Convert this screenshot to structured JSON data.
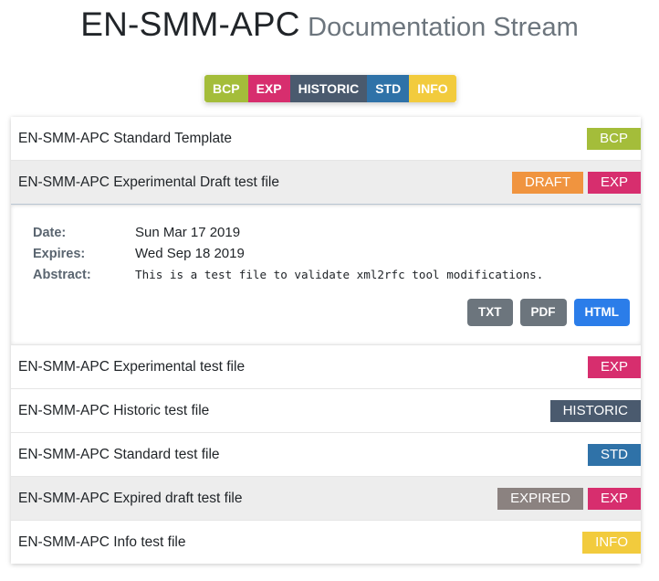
{
  "header": {
    "title": "EN-SMM-APC",
    "subtitle": "Documentation Stream"
  },
  "colors": {
    "bcp": "#a4bd3a",
    "exp": "#d72e6e",
    "historic": "#4a5a6e",
    "std": "#2f72a8",
    "info": "#f2cb3d",
    "draft": "#f0943f",
    "expired": "#8b8280",
    "btn_gray": "#6c757d",
    "btn_blue": "#2b7de9"
  },
  "filters": [
    {
      "label": "BCP",
      "color": "#a4bd3a"
    },
    {
      "label": "EXP",
      "color": "#d72e6e"
    },
    {
      "label": "HISTORIC",
      "color": "#4a5a6e"
    },
    {
      "label": "STD",
      "color": "#2f72a8"
    },
    {
      "label": "INFO",
      "color": "#f2cb3d"
    }
  ],
  "documents": [
    {
      "title": "EN-SMM-APC Standard Template",
      "badges": [
        {
          "label": "BCP",
          "color": "#a4bd3a"
        }
      ]
    },
    {
      "title": "EN-SMM-APC Experimental Draft test file",
      "badges": [
        {
          "label": "DRAFT",
          "color": "#f0943f"
        },
        {
          "label": "EXP",
          "color": "#d72e6e"
        }
      ]
    },
    {
      "title": "EN-SMM-APC Experimental test file",
      "badges": [
        {
          "label": "EXP",
          "color": "#d72e6e"
        }
      ]
    },
    {
      "title": "EN-SMM-APC Historic test file",
      "badges": [
        {
          "label": "HISTORIC",
          "color": "#4a5a6e"
        }
      ]
    },
    {
      "title": "EN-SMM-APC Standard test file",
      "badges": [
        {
          "label": "STD",
          "color": "#2f72a8"
        }
      ]
    },
    {
      "title": "EN-SMM-APC Expired draft test file",
      "badges": [
        {
          "label": "EXPIRED",
          "color": "#8b8280"
        },
        {
          "label": "EXP",
          "color": "#d72e6e"
        }
      ]
    },
    {
      "title": "EN-SMM-APC Info test file",
      "badges": [
        {
          "label": "INFO",
          "color": "#f2cb3d"
        }
      ]
    }
  ],
  "detail": {
    "date_label": "Date:",
    "date_value": "Sun Mar 17 2019",
    "expires_label": "Expires:",
    "expires_value": "Wed Sep 18 2019",
    "abstract_label": "Abstract:",
    "abstract_value": "This is a test file to validate xml2rfc tool modifications.",
    "buttons": [
      {
        "label": "TXT",
        "color": "#6c757d"
      },
      {
        "label": "PDF",
        "color": "#6c757d"
      },
      {
        "label": "HTML",
        "color": "#2b7de9"
      }
    ]
  }
}
